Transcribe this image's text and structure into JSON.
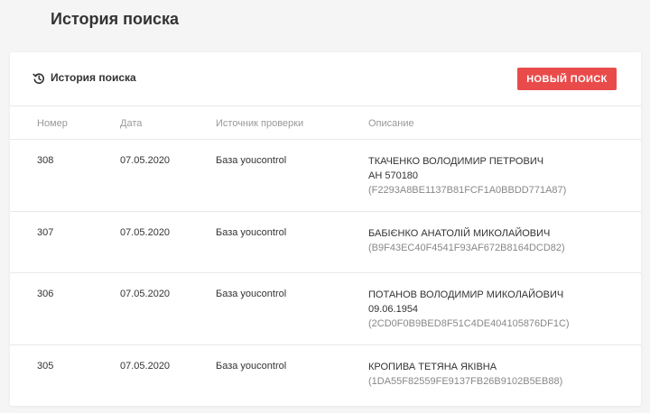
{
  "page_title": "История поиска",
  "card": {
    "title": "История поиска",
    "new_search_label": "НОВЫЙ ПОИСК"
  },
  "columns": {
    "number": "Номер",
    "date": "Дата",
    "source": "Источник проверки",
    "description": "Описание"
  },
  "rows": [
    {
      "number": "308",
      "date": "07.05.2020",
      "source": "База youcontrol",
      "lines": [
        "ТКАЧЕНКО ВОЛОДИМИР ПЕТРОВИЧ",
        "АН 570180"
      ],
      "hash": "(F2293A8BE1137B81FCF1A0BBDD771A87)"
    },
    {
      "number": "307",
      "date": "07.05.2020",
      "source": "База youcontrol",
      "lines": [
        "БАБІЄНКО АНАТОЛІЙ МИКОЛАЙОВИЧ"
      ],
      "hash": "(B9F43EC40F4541F93AF672B8164DCD82)"
    },
    {
      "number": "306",
      "date": "07.05.2020",
      "source": "База youcontrol",
      "lines": [
        "ПОТАНОВ ВОЛОДИМИР МИКОЛАЙОВИЧ",
        "09.06.1954"
      ],
      "hash": "(2CD0F0B9BED8F51C4DE404105876DF1C)"
    },
    {
      "number": "305",
      "date": "07.05.2020",
      "source": "База youcontrol",
      "lines": [
        "КРОПИВА ТЕТЯНА ЯКІВНА"
      ],
      "hash": "(1DA55F82559FE9137FB26B9102B5EB88)"
    }
  ],
  "colors": {
    "accent": "#e94b4b",
    "background": "#f5f5f5",
    "muted_text": "#999999"
  },
  "icons": {
    "history": "history-icon"
  }
}
